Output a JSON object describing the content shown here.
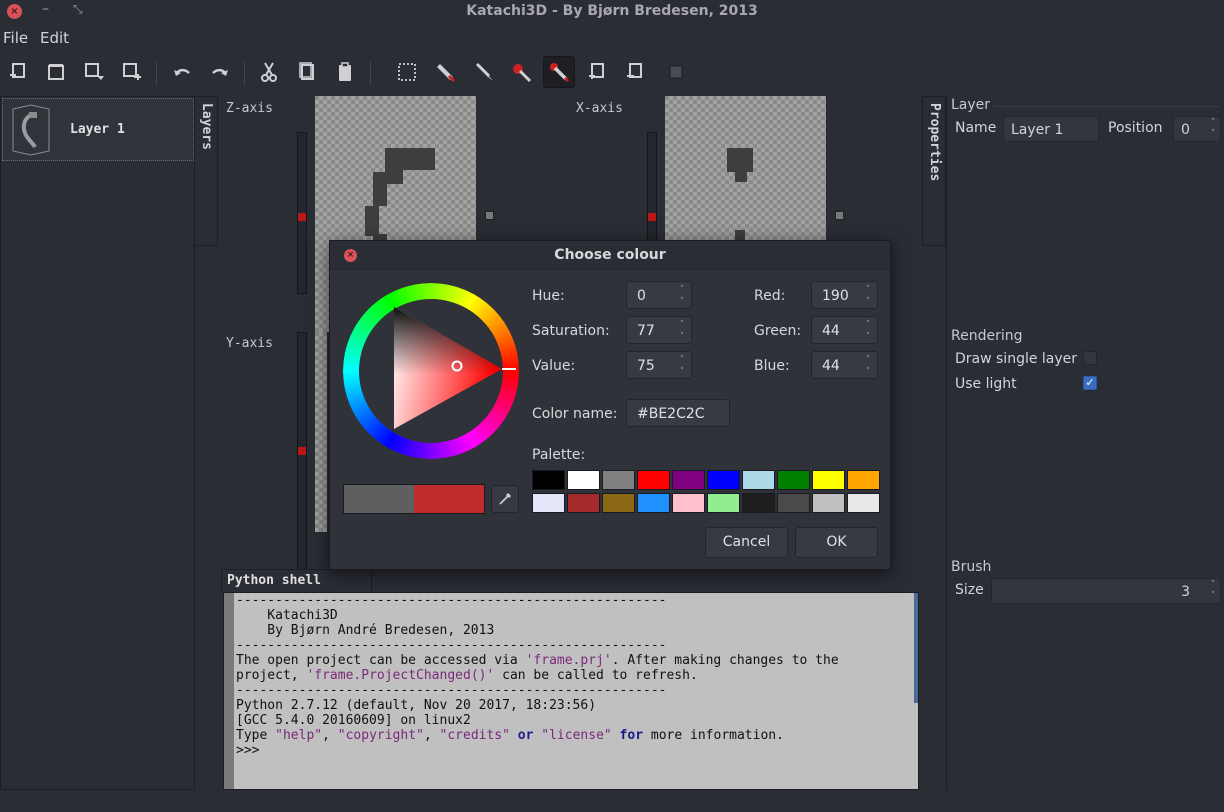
{
  "window": {
    "title": "Katachi3D - By Bjørn Bredesen, 2013",
    "close": "×",
    "minimize": "–",
    "maximize": "⤡"
  },
  "menu": {
    "file": "File",
    "edit": "Edit"
  },
  "layers": {
    "tab_label": "Layers",
    "items": [
      {
        "name": "Layer 1"
      }
    ]
  },
  "canvas": {
    "z_axis": "Z-axis",
    "x_axis": "X-axis",
    "y_axis": "Y-axis"
  },
  "properties": {
    "tab_label": "Properties",
    "layer_group": "Layer",
    "name_label": "Name",
    "name_value": "Layer 1",
    "position_label": "Position",
    "position_value": "0",
    "rendering_group": "Rendering",
    "draw_single_layer": "Draw single layer",
    "draw_single_layer_checked": false,
    "use_light": "Use light",
    "use_light_checked": true,
    "brush_group": "Brush",
    "size_label": "Size",
    "size_value": "3"
  },
  "shell": {
    "tab_label": "Python shell",
    "lines": [
      "-------------------------------------------------------",
      "    Katachi3D",
      "    By Bjørn André Bredesen, 2013",
      "-------------------------------------------------------"
    ],
    "line5a": "The open project can be accessed via ",
    "line5b": "'frame.prj'",
    "line5c": ". After making changes to the",
    "line6a": "project, ",
    "line6b": "'frame.ProjectChanged()'",
    "line6c": " can be called to refresh.",
    "line7": "-------------------------------------------------------",
    "line8": "Python 2.7.12 (default, Nov 20 2017, 18:23:56)",
    "line9": "[GCC 5.4.0 20160609] on linux2",
    "line10a": "Type ",
    "line10b": "\"help\"",
    "line10c": ", ",
    "line10d": "\"copyright\"",
    "line10e": ", ",
    "line10f": "\"credits\"",
    "line10g": " or ",
    "line10h": "\"license\"",
    "line10i": " for",
    "line10j": " more information.",
    "prompt": ">>>"
  },
  "dialog": {
    "title": "Choose colour",
    "close": "×",
    "hue_label": "Hue:",
    "hue": "0",
    "saturation_label": "Saturation:",
    "saturation": "77",
    "value_label": "Value:",
    "value": "75",
    "red_label": "Red:",
    "red": "190",
    "green_label": "Green:",
    "green": "44",
    "blue_label": "Blue:",
    "blue": "44",
    "color_name_label": "Color name:",
    "color_name": "#BE2C2C",
    "palette_label": "Palette:",
    "palette": [
      "#000000",
      "#ffffff",
      "#808080",
      "#ff0000",
      "#800080",
      "#0000ff",
      "#add8e6",
      "#008000",
      "#ffff00",
      "#ffa500",
      "#e6e6fa",
      "#a52a2a",
      "#8b6914",
      "#1e90ff",
      "#ffc0cb",
      "#90ee90",
      "#1e1e1e",
      "#4a4a4a",
      "#c0c0c0",
      "#e8e8e8"
    ],
    "old_color": "#5f5f5f",
    "new_color": "#be2c2c",
    "cancel": "Cancel",
    "ok": "OK"
  },
  "spin_arrows": {
    "up": "˄",
    "down": "˅"
  }
}
